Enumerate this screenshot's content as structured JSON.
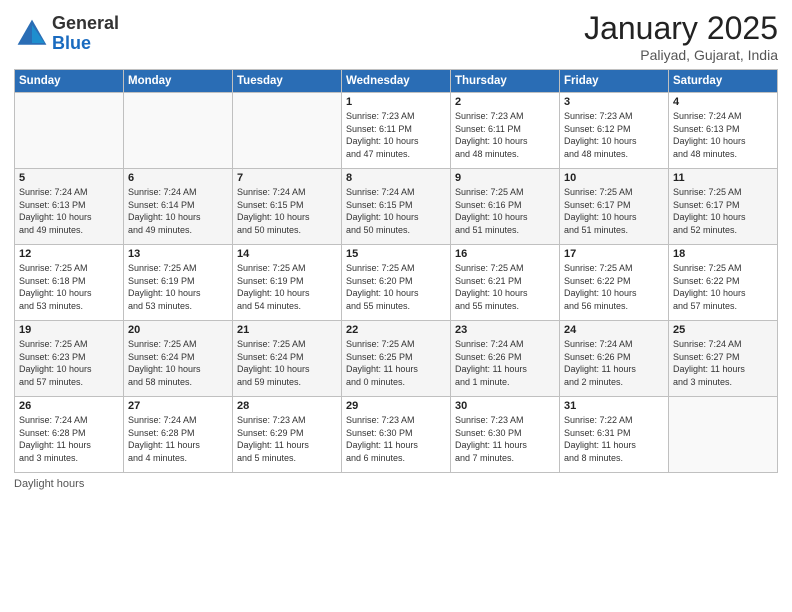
{
  "header": {
    "logo_general": "General",
    "logo_blue": "Blue",
    "month_title": "January 2025",
    "location": "Paliyad, Gujarat, India"
  },
  "days_of_week": [
    "Sunday",
    "Monday",
    "Tuesday",
    "Wednesday",
    "Thursday",
    "Friday",
    "Saturday"
  ],
  "weeks": [
    [
      {
        "day": "",
        "info": ""
      },
      {
        "day": "",
        "info": ""
      },
      {
        "day": "",
        "info": ""
      },
      {
        "day": "1",
        "info": "Sunrise: 7:23 AM\nSunset: 6:11 PM\nDaylight: 10 hours\nand 47 minutes."
      },
      {
        "day": "2",
        "info": "Sunrise: 7:23 AM\nSunset: 6:11 PM\nDaylight: 10 hours\nand 48 minutes."
      },
      {
        "day": "3",
        "info": "Sunrise: 7:23 AM\nSunset: 6:12 PM\nDaylight: 10 hours\nand 48 minutes."
      },
      {
        "day": "4",
        "info": "Sunrise: 7:24 AM\nSunset: 6:13 PM\nDaylight: 10 hours\nand 48 minutes."
      }
    ],
    [
      {
        "day": "5",
        "info": "Sunrise: 7:24 AM\nSunset: 6:13 PM\nDaylight: 10 hours\nand 49 minutes."
      },
      {
        "day": "6",
        "info": "Sunrise: 7:24 AM\nSunset: 6:14 PM\nDaylight: 10 hours\nand 49 minutes."
      },
      {
        "day": "7",
        "info": "Sunrise: 7:24 AM\nSunset: 6:15 PM\nDaylight: 10 hours\nand 50 minutes."
      },
      {
        "day": "8",
        "info": "Sunrise: 7:24 AM\nSunset: 6:15 PM\nDaylight: 10 hours\nand 50 minutes."
      },
      {
        "day": "9",
        "info": "Sunrise: 7:25 AM\nSunset: 6:16 PM\nDaylight: 10 hours\nand 51 minutes."
      },
      {
        "day": "10",
        "info": "Sunrise: 7:25 AM\nSunset: 6:17 PM\nDaylight: 10 hours\nand 51 minutes."
      },
      {
        "day": "11",
        "info": "Sunrise: 7:25 AM\nSunset: 6:17 PM\nDaylight: 10 hours\nand 52 minutes."
      }
    ],
    [
      {
        "day": "12",
        "info": "Sunrise: 7:25 AM\nSunset: 6:18 PM\nDaylight: 10 hours\nand 53 minutes."
      },
      {
        "day": "13",
        "info": "Sunrise: 7:25 AM\nSunset: 6:19 PM\nDaylight: 10 hours\nand 53 minutes."
      },
      {
        "day": "14",
        "info": "Sunrise: 7:25 AM\nSunset: 6:19 PM\nDaylight: 10 hours\nand 54 minutes."
      },
      {
        "day": "15",
        "info": "Sunrise: 7:25 AM\nSunset: 6:20 PM\nDaylight: 10 hours\nand 55 minutes."
      },
      {
        "day": "16",
        "info": "Sunrise: 7:25 AM\nSunset: 6:21 PM\nDaylight: 10 hours\nand 55 minutes."
      },
      {
        "day": "17",
        "info": "Sunrise: 7:25 AM\nSunset: 6:22 PM\nDaylight: 10 hours\nand 56 minutes."
      },
      {
        "day": "18",
        "info": "Sunrise: 7:25 AM\nSunset: 6:22 PM\nDaylight: 10 hours\nand 57 minutes."
      }
    ],
    [
      {
        "day": "19",
        "info": "Sunrise: 7:25 AM\nSunset: 6:23 PM\nDaylight: 10 hours\nand 57 minutes."
      },
      {
        "day": "20",
        "info": "Sunrise: 7:25 AM\nSunset: 6:24 PM\nDaylight: 10 hours\nand 58 minutes."
      },
      {
        "day": "21",
        "info": "Sunrise: 7:25 AM\nSunset: 6:24 PM\nDaylight: 10 hours\nand 59 minutes."
      },
      {
        "day": "22",
        "info": "Sunrise: 7:25 AM\nSunset: 6:25 PM\nDaylight: 11 hours\nand 0 minutes."
      },
      {
        "day": "23",
        "info": "Sunrise: 7:24 AM\nSunset: 6:26 PM\nDaylight: 11 hours\nand 1 minute."
      },
      {
        "day": "24",
        "info": "Sunrise: 7:24 AM\nSunset: 6:26 PM\nDaylight: 11 hours\nand 2 minutes."
      },
      {
        "day": "25",
        "info": "Sunrise: 7:24 AM\nSunset: 6:27 PM\nDaylight: 11 hours\nand 3 minutes."
      }
    ],
    [
      {
        "day": "26",
        "info": "Sunrise: 7:24 AM\nSunset: 6:28 PM\nDaylight: 11 hours\nand 3 minutes."
      },
      {
        "day": "27",
        "info": "Sunrise: 7:24 AM\nSunset: 6:28 PM\nDaylight: 11 hours\nand 4 minutes."
      },
      {
        "day": "28",
        "info": "Sunrise: 7:23 AM\nSunset: 6:29 PM\nDaylight: 11 hours\nand 5 minutes."
      },
      {
        "day": "29",
        "info": "Sunrise: 7:23 AM\nSunset: 6:30 PM\nDaylight: 11 hours\nand 6 minutes."
      },
      {
        "day": "30",
        "info": "Sunrise: 7:23 AM\nSunset: 6:30 PM\nDaylight: 11 hours\nand 7 minutes."
      },
      {
        "day": "31",
        "info": "Sunrise: 7:22 AM\nSunset: 6:31 PM\nDaylight: 11 hours\nand 8 minutes."
      },
      {
        "day": "",
        "info": ""
      }
    ]
  ],
  "footer": {
    "daylight_hours": "Daylight hours"
  }
}
